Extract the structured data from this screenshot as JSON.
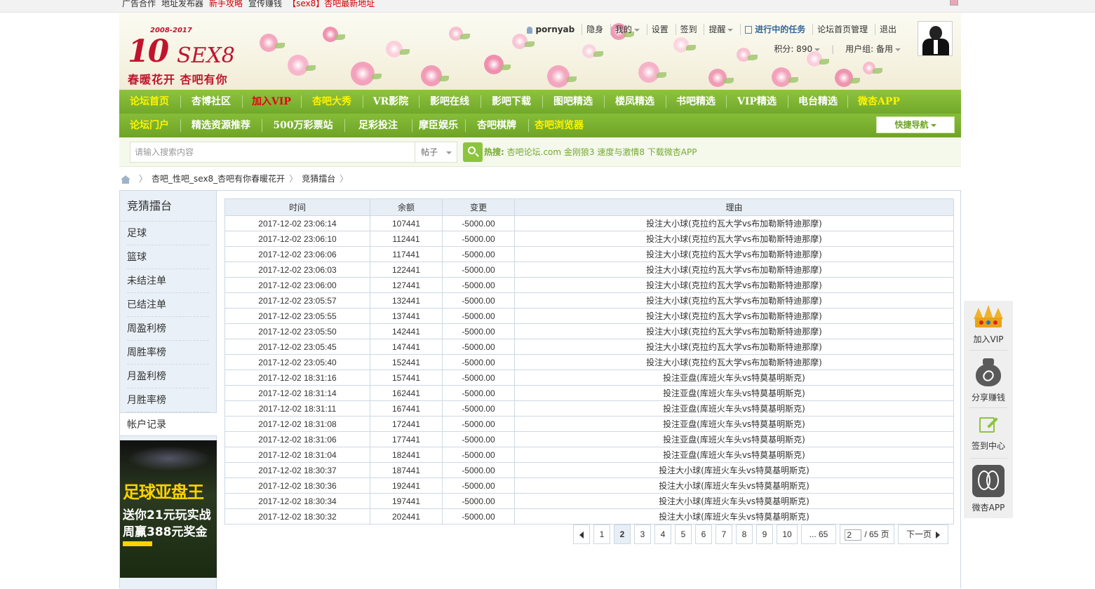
{
  "topbar": {
    "links": [
      {
        "label": "广告合作",
        "color": "normal"
      },
      {
        "label": "地址发布器",
        "color": "normal"
      },
      {
        "label": "新手攻略",
        "color": "red"
      },
      {
        "label": "宣传赚钱",
        "color": "normal"
      },
      {
        "label": "【sex8】杏吧最新地址",
        "color": "red"
      }
    ]
  },
  "header": {
    "logo_years": "2008-2017",
    "logo_big": "10",
    "logo_sex": "SEX8",
    "slogan": "春暖花开 杏吧有你",
    "user": {
      "username": "pornyab",
      "items": [
        "隐身",
        "我的",
        "设置",
        "签到",
        "提醒"
      ],
      "task": "进行中的任务",
      "admin": "论坛首页管理",
      "logout": "退出",
      "points_label": "积分: 890",
      "group_label": "用户组: 备用"
    }
  },
  "nav1": [
    {
      "label": "论坛首页",
      "style": "yellow"
    },
    {
      "label": "杏博社区",
      "style": "white"
    },
    {
      "label": "加入VIP",
      "style": "red"
    },
    {
      "label": "杏吧大秀",
      "style": "yellow"
    },
    {
      "label": "VR影院",
      "style": "white"
    },
    {
      "label": "影吧在线",
      "style": "white"
    },
    {
      "label": "影吧下载",
      "style": "white"
    },
    {
      "label": "图吧精选",
      "style": "white"
    },
    {
      "label": "楼凤精选",
      "style": "white"
    },
    {
      "label": "书吧精选",
      "style": "white"
    },
    {
      "label": "VIP精选",
      "style": "white"
    },
    {
      "label": "电台精选",
      "style": "white"
    },
    {
      "label": "微杏APP",
      "style": "yellow"
    }
  ],
  "nav2": [
    {
      "label": "论坛门户",
      "style": "yellow"
    },
    {
      "label": "精选资源推荐",
      "style": "white"
    },
    {
      "label": "500万彩票站",
      "style": "white"
    },
    {
      "label": "足彩投注",
      "style": "white"
    },
    {
      "label": "摩臣娱乐",
      "style": "white"
    },
    {
      "label": "杏吧棋牌",
      "style": "white"
    },
    {
      "label": "杏吧浏览器",
      "style": "yellow"
    }
  ],
  "quicknav": "快捷导航",
  "search": {
    "placeholder": "请输入搜索内容",
    "type": "帖子",
    "hot_label": "热搜:",
    "hot_items": "杏吧论坛.com 金刚狼3 速度与激情8 下载微杏APP"
  },
  "breadcrumb": [
    "杏吧_性吧_sex8_杏吧有你春暖花开",
    "竞猜擂台"
  ],
  "sidebar": {
    "title": "竞猜擂台",
    "items": [
      "足球",
      "篮球",
      "未结注单",
      "已结注单",
      "周盈利榜",
      "周胜率榜",
      "月盈利榜",
      "月胜率榜"
    ],
    "active": "帐户记录",
    "ad": {
      "line1": "足球亚盘王",
      "line2": "送你21元玩实战",
      "line3": "周赢388元奖金"
    }
  },
  "table": {
    "headers": [
      "时间",
      "余额",
      "变更",
      "理由"
    ],
    "rows": [
      [
        "2017-12-02 23:06:14",
        "107441",
        "-5000.00",
        "投注大小球(克拉约瓦大学vs布加勒斯特迪那摩)"
      ],
      [
        "2017-12-02 23:06:10",
        "112441",
        "-5000.00",
        "投注大小球(克拉约瓦大学vs布加勒斯特迪那摩)"
      ],
      [
        "2017-12-02 23:06:06",
        "117441",
        "-5000.00",
        "投注大小球(克拉约瓦大学vs布加勒斯特迪那摩)"
      ],
      [
        "2017-12-02 23:06:03",
        "122441",
        "-5000.00",
        "投注大小球(克拉约瓦大学vs布加勒斯特迪那摩)"
      ],
      [
        "2017-12-02 23:06:00",
        "127441",
        "-5000.00",
        "投注大小球(克拉约瓦大学vs布加勒斯特迪那摩)"
      ],
      [
        "2017-12-02 23:05:57",
        "132441",
        "-5000.00",
        "投注大小球(克拉约瓦大学vs布加勒斯特迪那摩)"
      ],
      [
        "2017-12-02 23:05:55",
        "137441",
        "-5000.00",
        "投注大小球(克拉约瓦大学vs布加勒斯特迪那摩)"
      ],
      [
        "2017-12-02 23:05:50",
        "142441",
        "-5000.00",
        "投注大小球(克拉约瓦大学vs布加勒斯特迪那摩)"
      ],
      [
        "2017-12-02 23:05:45",
        "147441",
        "-5000.00",
        "投注大小球(克拉约瓦大学vs布加勒斯特迪那摩)"
      ],
      [
        "2017-12-02 23:05:40",
        "152441",
        "-5000.00",
        "投注大小球(克拉约瓦大学vs布加勒斯特迪那摩)"
      ],
      [
        "2017-12-02 18:31:16",
        "157441",
        "-5000.00",
        "投注亚盘(库班火车头vs特莫基明斯克)"
      ],
      [
        "2017-12-02 18:31:14",
        "162441",
        "-5000.00",
        "投注亚盘(库班火车头vs特莫基明斯克)"
      ],
      [
        "2017-12-02 18:31:11",
        "167441",
        "-5000.00",
        "投注亚盘(库班火车头vs特莫基明斯克)"
      ],
      [
        "2017-12-02 18:31:08",
        "172441",
        "-5000.00",
        "投注亚盘(库班火车头vs特莫基明斯克)"
      ],
      [
        "2017-12-02 18:31:06",
        "177441",
        "-5000.00",
        "投注亚盘(库班火车头vs特莫基明斯克)"
      ],
      [
        "2017-12-02 18:31:04",
        "182441",
        "-5000.00",
        "投注亚盘(库班火车头vs特莫基明斯克)"
      ],
      [
        "2017-12-02 18:30:37",
        "187441",
        "-5000.00",
        "投注大小球(库班火车头vs特莫基明斯克)"
      ],
      [
        "2017-12-02 18:30:36",
        "192441",
        "-5000.00",
        "投注大小球(库班火车头vs特莫基明斯克)"
      ],
      [
        "2017-12-02 18:30:34",
        "197441",
        "-5000.00",
        "投注大小球(库班火车头vs特莫基明斯克)"
      ],
      [
        "2017-12-02 18:30:32",
        "202441",
        "-5000.00",
        "投注大小球(库班火车头vs特莫基明斯克)"
      ]
    ]
  },
  "pagination": {
    "pages": [
      "1",
      "2",
      "3",
      "4",
      "5",
      "6",
      "7",
      "8",
      "9",
      "10"
    ],
    "current": "2",
    "last": "... 65",
    "input_value": "2",
    "total": "/ 65 页",
    "next": "下一页"
  },
  "floatbar": {
    "vip": "加入VIP",
    "share": "分享赚钱",
    "signin": "签到中心",
    "app": "微杏APP"
  },
  "colors": {
    "nav_green": "#7fb534",
    "hot_green": "#76a832",
    "brand_red": "#c0142c"
  }
}
